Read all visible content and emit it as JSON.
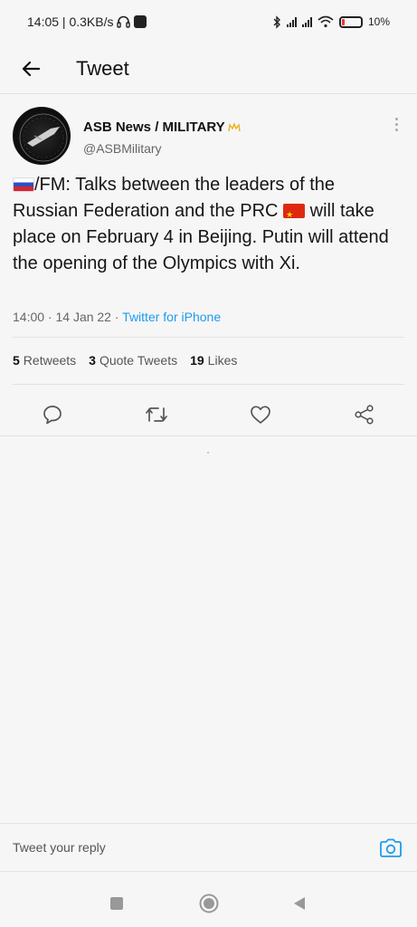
{
  "status_bar": {
    "time_net": "14:05 | 0.3KB/s",
    "battery": "10%"
  },
  "header": {
    "title": "Tweet",
    "back_icon": "arrow-left-icon"
  },
  "tweet": {
    "author_name": "ASB News / MILITARY",
    "author_handle": "@ASBMilitary",
    "text_part1": "/FM: Talks between the leaders of the Russian Federation and the PRC",
    "text_part2": "will take place on February 4 in Beijing. Putin will attend the opening of the Olympics with Xi.",
    "time": "14:00 · 14 Jan 22 · ",
    "source": "Twitter for iPhone",
    "stats": {
      "retweets_count": "5",
      "retweets_label": "Retweets",
      "quotes_count": "3",
      "quotes_label": "Quote Tweets",
      "likes_count": "19",
      "likes_label": "Likes"
    }
  },
  "reply": {
    "placeholder": "Tweet your reply"
  },
  "colors": {
    "accent": "#1d9bf0",
    "background": "#f6f6f6",
    "crown": "#e8b020"
  }
}
